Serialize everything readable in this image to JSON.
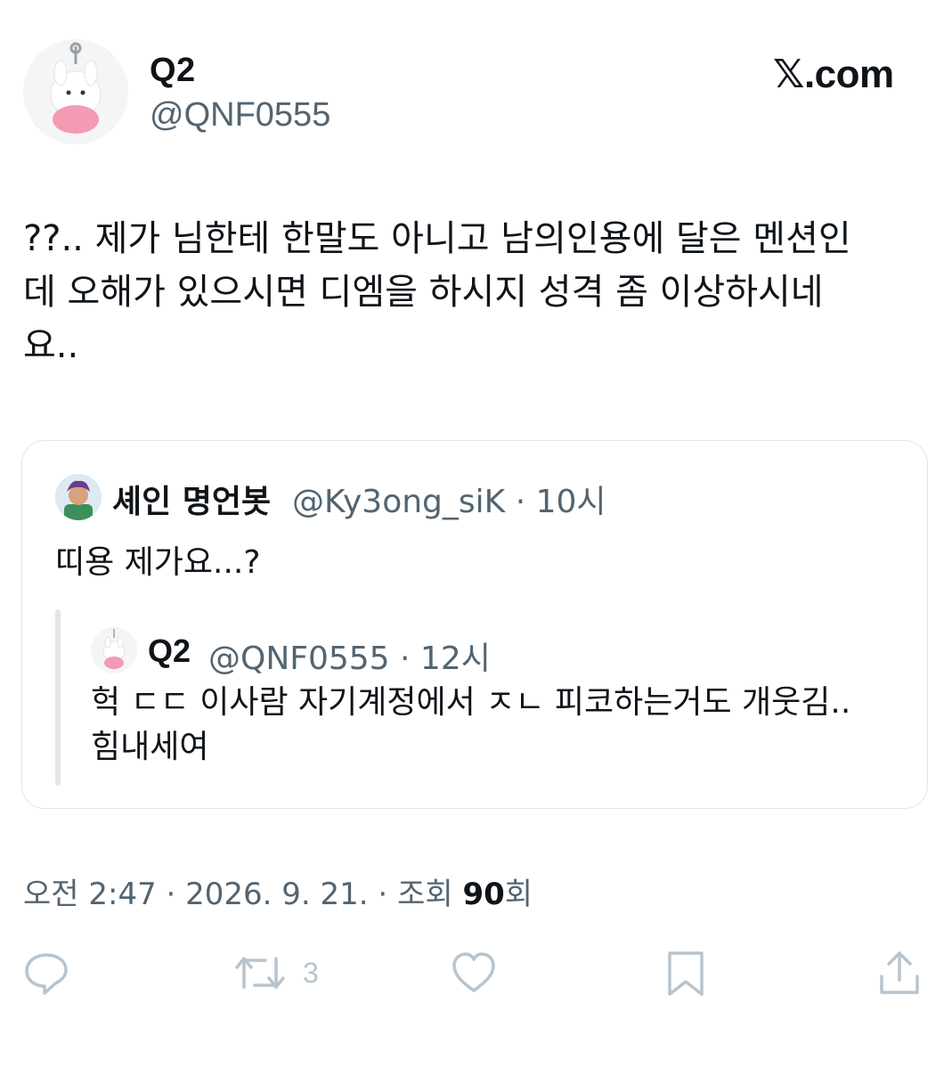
{
  "header": {
    "display_name": "Q2",
    "handle": "@QNF0555",
    "brand": "𝕏.com"
  },
  "tweet": {
    "text": "??.. 제가 님한테 한말도 아니고 남의인용에 달은 멘션인\n데 오해가 있으시면 디엠을 하시지 성격 좀 이상하시네\n요.."
  },
  "quote": {
    "display_name": "셰인 명언봇",
    "meta": "@Ky3ong_siK · 10시",
    "text": "띠용 제가요...?",
    "nested": {
      "display_name": "Q2",
      "meta": "@QNF0555 · 12시",
      "text": "헉 ㄷㄷ 이사람 자기계정에서 ㅈㄴ 피코하는거도 개웃김..\n힘내세여"
    }
  },
  "footer": {
    "time": "오전 2:47",
    "date": "2026. 9. 21.",
    "views_prefix": "조회",
    "views_count": "90",
    "views_suffix": "회"
  },
  "actions": {
    "retweet_count": "3",
    "icons": [
      "reply-icon",
      "retweet-icon",
      "like-icon",
      "bookmark-icon",
      "share-icon"
    ],
    "icon_color": "#b8c4cd"
  }
}
